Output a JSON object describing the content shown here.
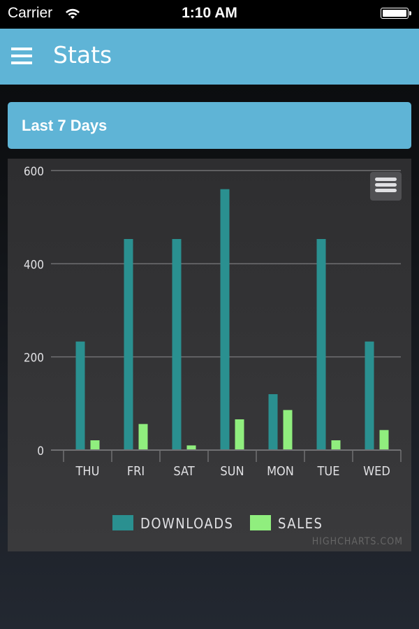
{
  "status_bar": {
    "carrier": "Carrier",
    "time": "1:10 AM",
    "wifi_icon": "wifi-icon",
    "battery_icon": "battery-icon"
  },
  "navbar": {
    "menu_icon": "hamburger-menu-icon",
    "title": "Stats"
  },
  "section": {
    "title": "Last 7 Days"
  },
  "chart": {
    "export_icon": "export-menu-icon",
    "credits": "HIGHCHARTS.COM"
  },
  "colors": {
    "accent": "#5fb4d6",
    "downloads": "#2a9090",
    "sales": "#90ee7e",
    "grid": "#707073",
    "label": "#e0e0e3",
    "credits": "#666666"
  },
  "chart_data": {
    "type": "bar",
    "title": "",
    "xlabel": "",
    "ylabel": "",
    "categories": [
      "THU",
      "FRI",
      "SAT",
      "SUN",
      "MON",
      "TUE",
      "WED"
    ],
    "series": [
      {
        "name": "DOWNLOADS",
        "values": [
          233,
          453,
          453,
          560,
          120,
          453,
          233
        ]
      },
      {
        "name": "SALES",
        "values": [
          21,
          56,
          10,
          66,
          86,
          21,
          43
        ]
      }
    ],
    "ylim": [
      0,
      600
    ],
    "yticks": [
      0,
      200,
      400,
      600
    ],
    "grid": true,
    "legend": "bottom-center"
  }
}
